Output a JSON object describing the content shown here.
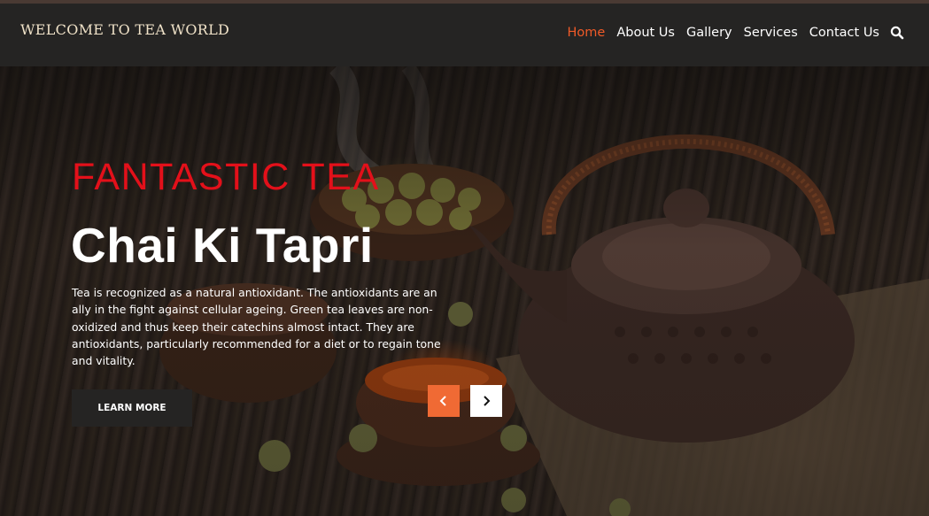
{
  "header": {
    "brand": "WELCOME TO TEA WORLD",
    "nav": [
      {
        "label": "Home",
        "active": true
      },
      {
        "label": "About Us",
        "active": false
      },
      {
        "label": "Gallery",
        "active": false
      },
      {
        "label": "Services",
        "active": false
      },
      {
        "label": "Contact Us",
        "active": false
      }
    ],
    "search_icon": "search-icon"
  },
  "hero": {
    "kicker": "FANTASTIC TEA",
    "title": "Chai Ki Tapri",
    "description": "Tea is recognized as a natural antioxidant. The antioxidants are an ally in the fight against cellular ageing. Green tea leaves are non-oxidized and thus keep their catechins almost intact. They are antioxidants, particularly recommended for a diet or to regain tone and vitality.",
    "button_label": "LEARN MORE",
    "prev_icon": "chevron-left-icon",
    "next_icon": "chevron-right-icon"
  },
  "colors": {
    "accent": "#f05a28",
    "kicker": "#e3101a",
    "navbar_bg": "#252423",
    "prev_bg": "#f06a34"
  }
}
